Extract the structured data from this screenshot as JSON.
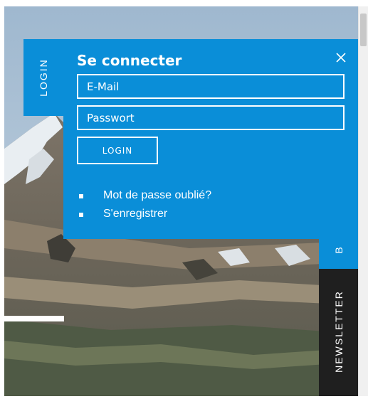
{
  "login_tab": {
    "label": "LOGIN"
  },
  "login_panel": {
    "title": "Se connecter",
    "email_placeholder": "E-Mail",
    "password_placeholder": "Passwort",
    "submit_label": "LOGIN",
    "links": [
      {
        "label": "Mot de passe oublié?"
      },
      {
        "label": "S'enregistrer"
      }
    ],
    "close_icon": "close-icon"
  },
  "side_tabs": {
    "partial_tab_label": "B",
    "newsletter_label": "NEWSLETTER"
  },
  "colors": {
    "accent": "#0a8ed8",
    "dark_tab": "#1f1f1f",
    "text": "#ffffff"
  }
}
